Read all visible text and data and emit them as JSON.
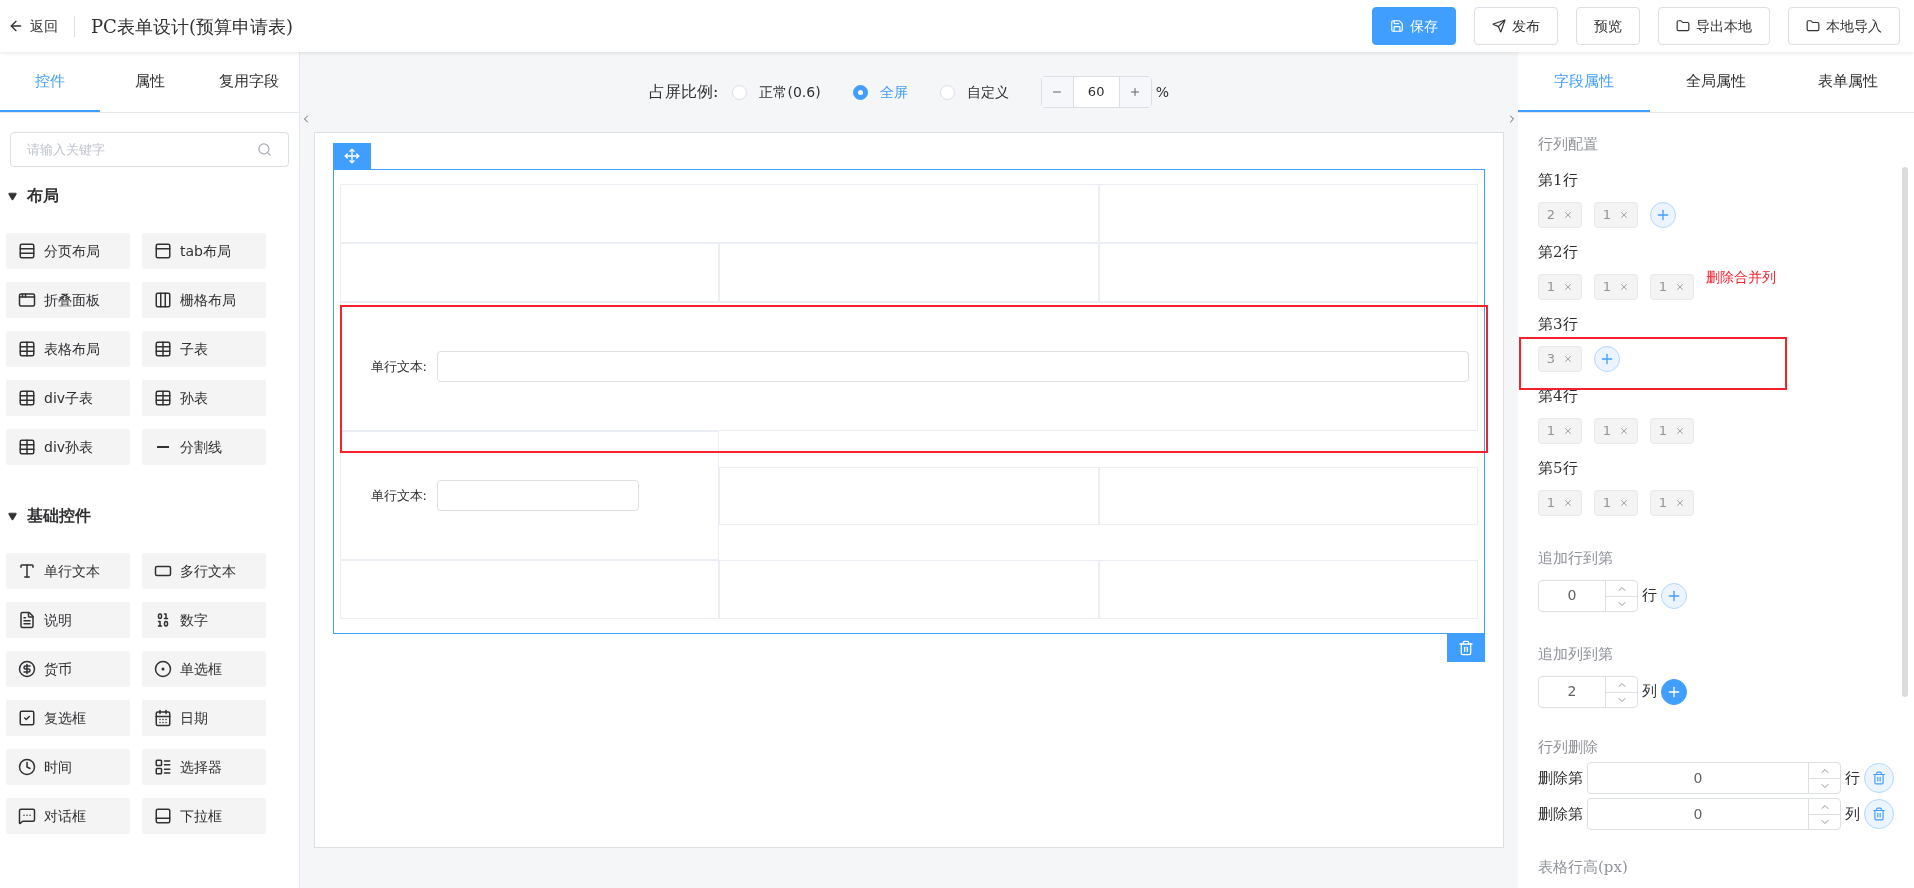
{
  "topbar": {
    "back_label": "返回",
    "title": "PC表单设计(预算申请表)",
    "buttons": [
      {
        "label": "保存",
        "primary": true
      },
      {
        "label": "发布",
        "primary": false
      },
      {
        "label": "预览",
        "primary": false
      },
      {
        "label": "导出本地",
        "primary": false
      },
      {
        "label": "本地导入",
        "primary": false
      }
    ]
  },
  "left_panel": {
    "tabs": [
      {
        "label": "控件",
        "selected": true
      },
      {
        "label": "属性",
        "selected": false
      },
      {
        "label": "复用字段",
        "selected": false
      }
    ],
    "search": {
      "placeholder": "请输入关键字"
    },
    "sections": [
      {
        "title": "布局",
        "expanded": true,
        "items": [
          {
            "label": "分页布局"
          },
          {
            "label": "tab布局"
          },
          {
            "label": "折叠面板"
          },
          {
            "label": "栅格布局"
          },
          {
            "label": "表格布局"
          },
          {
            "label": "子表"
          },
          {
            "label": "div子表"
          },
          {
            "label": "孙表"
          },
          {
            "label": "div孙表"
          },
          {
            "label": "分割线"
          }
        ]
      },
      {
        "title": "基础控件",
        "expanded": true,
        "items": [
          {
            "label": "单行文本"
          },
          {
            "label": "多行文本"
          },
          {
            "label": "说明"
          },
          {
            "label": "数字"
          },
          {
            "label": "货币"
          },
          {
            "label": "单选框"
          },
          {
            "label": "复选框"
          },
          {
            "label": "日期"
          },
          {
            "label": "时间"
          },
          {
            "label": "选择器"
          },
          {
            "label": "对话框"
          },
          {
            "label": "下拉框"
          }
        ]
      }
    ]
  },
  "canvas": {
    "ratio_label": "占屏比例:",
    "ratio_options": [
      {
        "label": "正常(0.6)",
        "selected": false
      },
      {
        "label": "全屏",
        "selected": true
      },
      {
        "label": "自定义",
        "selected": false
      }
    ],
    "zoom": {
      "value": "60",
      "unit": "%"
    },
    "table": {
      "rows": [
        {
          "cells": [
            {},
            {}
          ]
        },
        {
          "cells": [
            {},
            {},
            {}
          ]
        },
        {
          "cells": [
            {
              "field_label": "单行文本:"
            }
          ]
        },
        {
          "cells": [
            {
              "field_label": "单行文本:"
            },
            {},
            {}
          ]
        },
        {
          "cells": [
            {},
            {},
            {}
          ]
        }
      ]
    }
  },
  "right_panel": {
    "tabs": [
      {
        "label": "字段属性",
        "selected": true
      },
      {
        "label": "全局属性",
        "selected": false
      },
      {
        "label": "表单属性",
        "selected": false
      }
    ],
    "config_title": "行列配置",
    "rows": [
      {
        "label": "第1行",
        "chips": [
          "2",
          "1"
        ],
        "can_add": true
      },
      {
        "label": "第2行",
        "chips": [
          "1",
          "1",
          "1"
        ],
        "can_add": false,
        "note": "删除合并列"
      },
      {
        "label": "第3行",
        "chips": [
          "3"
        ],
        "can_add": true
      },
      {
        "label": "第4行",
        "chips": [
          "1",
          "1",
          "1"
        ],
        "can_add": false
      },
      {
        "label": "第5行",
        "chips": [
          "1",
          "1",
          "1"
        ],
        "can_add": false
      }
    ],
    "add_row": {
      "title": "追加行到第",
      "value": "0",
      "unit": "行",
      "active": false
    },
    "add_col": {
      "title": "追加列到第",
      "value": "2",
      "unit": "列",
      "active": true
    },
    "delete_title": "行列删除",
    "deletes": [
      {
        "label": "删除第",
        "value": "0",
        "unit": "行"
      },
      {
        "label": "删除第",
        "value": "0",
        "unit": "列"
      }
    ],
    "row_height_title": "表格行高(px)"
  }
}
